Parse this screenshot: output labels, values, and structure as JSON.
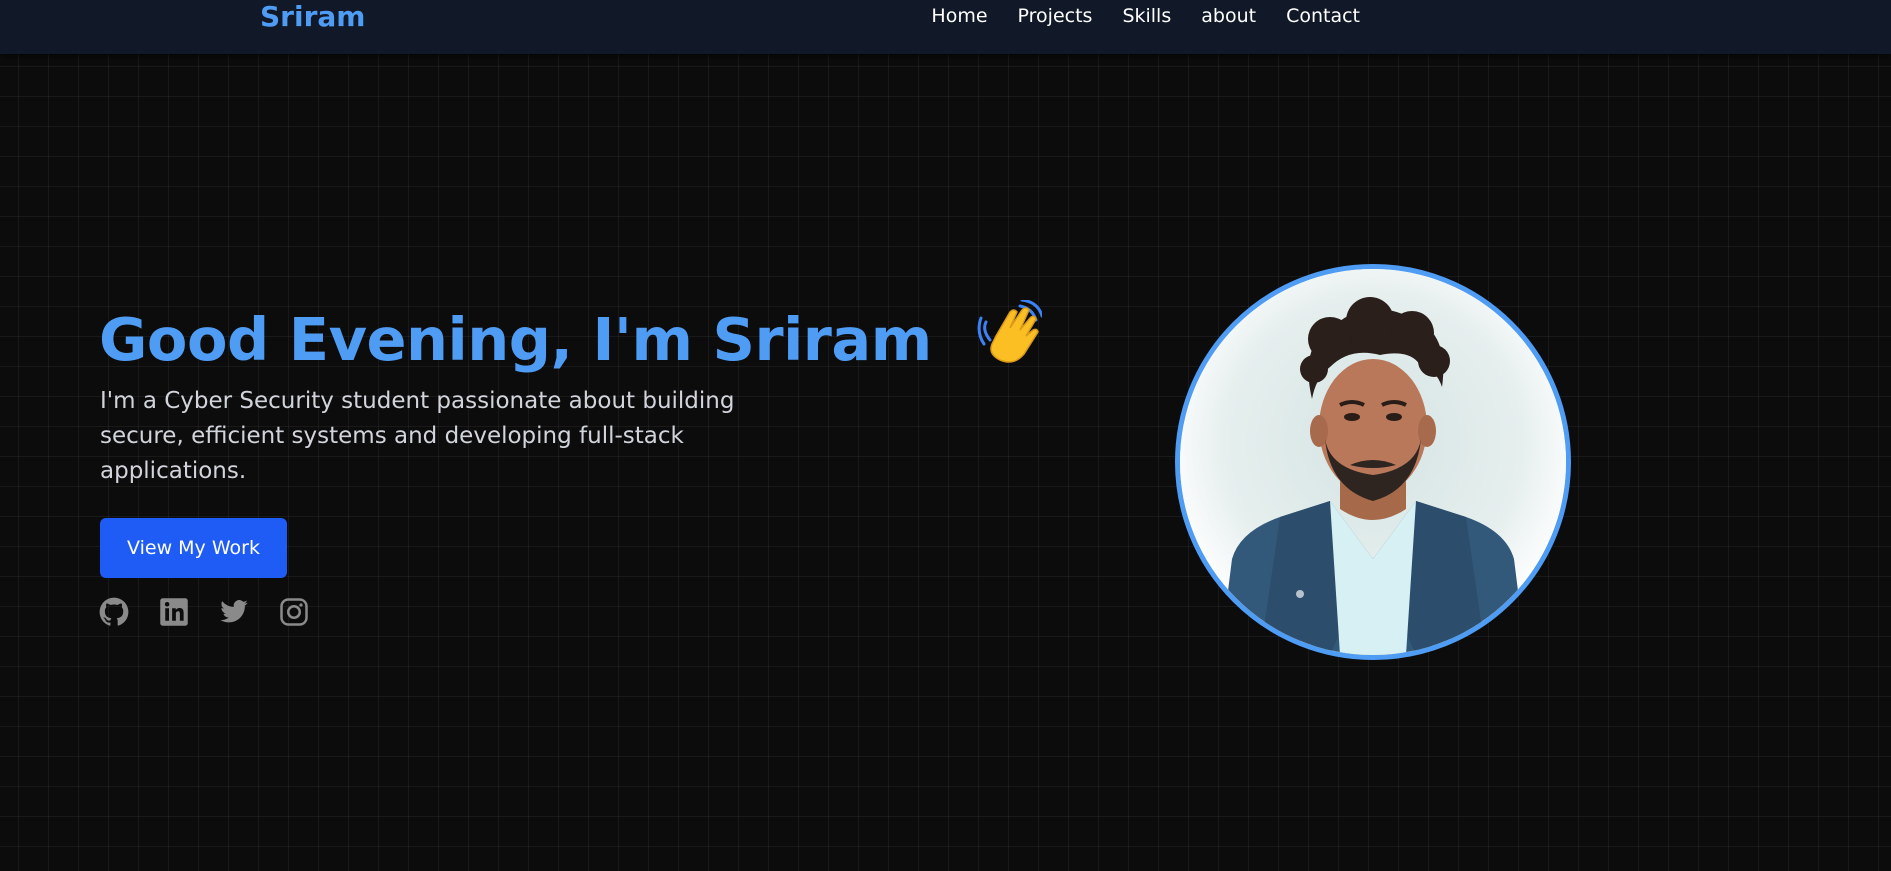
{
  "nav": {
    "brand": "Sriram",
    "links": [
      "Home",
      "Projects",
      "Skills",
      "about",
      "Contact"
    ]
  },
  "hero": {
    "title": "Good Evening, I'm Sriram",
    "description": "I'm a Cyber Security student passionate about building secure, efficient systems and developing full-stack applications.",
    "cta_label": "View My Work",
    "wave_icon": "waving-hand-icon"
  },
  "socials": [
    "github-icon",
    "linkedin-icon",
    "twitter-icon",
    "instagram-icon"
  ],
  "profile": {
    "image": "profile-photo"
  },
  "colors": {
    "accent": "#4f9cf4",
    "button": "#1f5cf5",
    "navbar": "#111827",
    "background": "#0c0c0d",
    "text_muted": "#d1d5db",
    "icon": "#8a8a8a"
  }
}
